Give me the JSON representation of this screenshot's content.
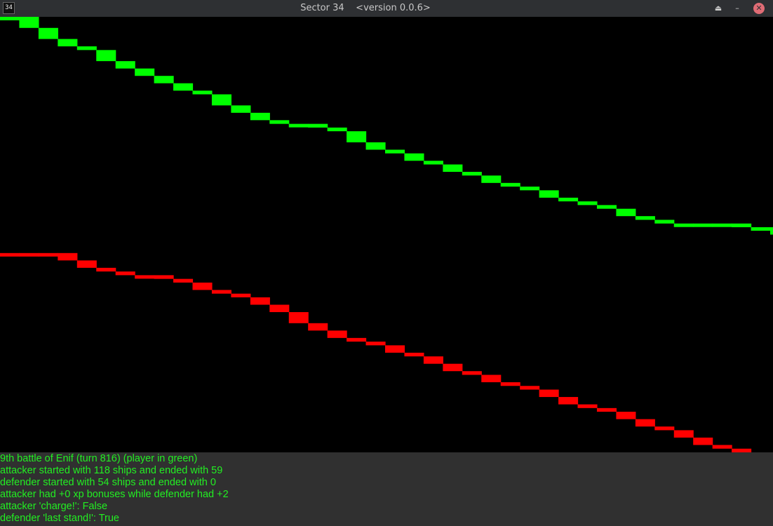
{
  "window": {
    "app_icon_text": "34",
    "title": "Sector 34    <version 0.0.6>",
    "eject_icon": "⏏",
    "minimize_icon": "–",
    "close_icon": "✕"
  },
  "colors": {
    "attacker": "#00ff00",
    "defender": "#ff0000",
    "log_text": "#22ee22",
    "log_bg": "#303030"
  },
  "chart_data": {
    "type": "line",
    "description_source": "step plot of ship counts per combat round",
    "ylim": [
      0,
      118
    ],
    "series": [
      {
        "side": "attacker",
        "values": [
          118,
          115,
          112,
          110,
          109,
          106,
          104,
          102,
          100,
          98,
          97,
          94,
          92,
          90,
          89,
          89,
          88,
          87,
          84,
          82,
          81,
          79,
          78,
          76,
          75,
          73,
          72,
          71,
          69,
          68,
          67,
          66,
          64,
          63,
          62,
          62,
          62,
          62,
          61,
          61,
          59
        ]
      },
      {
        "side": "defender",
        "values": [
          54,
          54,
          54,
          52,
          50,
          49,
          48,
          48,
          47,
          46,
          44,
          43,
          42,
          40,
          38,
          35,
          33,
          31,
          30,
          29,
          27,
          26,
          24,
          22,
          21,
          19,
          18,
          17,
          15,
          13,
          12,
          11,
          9,
          7,
          6,
          4,
          2,
          1,
          0
        ]
      }
    ]
  },
  "log": {
    "lines": [
      "9th battle of Enif (turn 816) (player in green)",
      "attacker started with 118 ships and ended with 59",
      "defender started with 54 ships and ended with 0",
      "attacker had +0 xp bonuses while defender had +2",
      "attacker 'charge!': False",
      "defender 'last stand!': True"
    ]
  }
}
